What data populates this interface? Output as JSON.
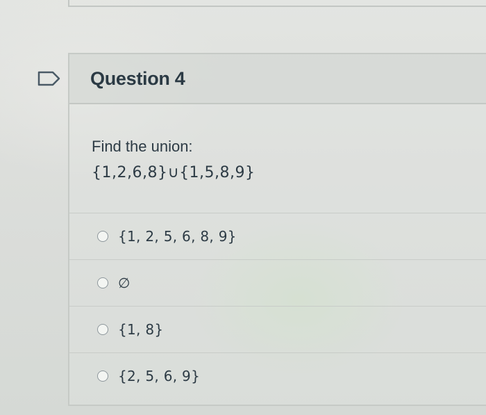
{
  "question": {
    "title": "Question 4",
    "prompt": "Find the union:",
    "expression": "{1,2,6,8}∪{1,5,8,9}"
  },
  "answers": [
    {
      "label": "{1, 2, 5, 6, 8, 9}"
    },
    {
      "label": "∅"
    },
    {
      "label": "{1, 8}"
    },
    {
      "label": "{2, 5, 6, 9}"
    }
  ],
  "icons": {
    "flag": "flag-question-icon",
    "radio": "radio-button-icon"
  }
}
